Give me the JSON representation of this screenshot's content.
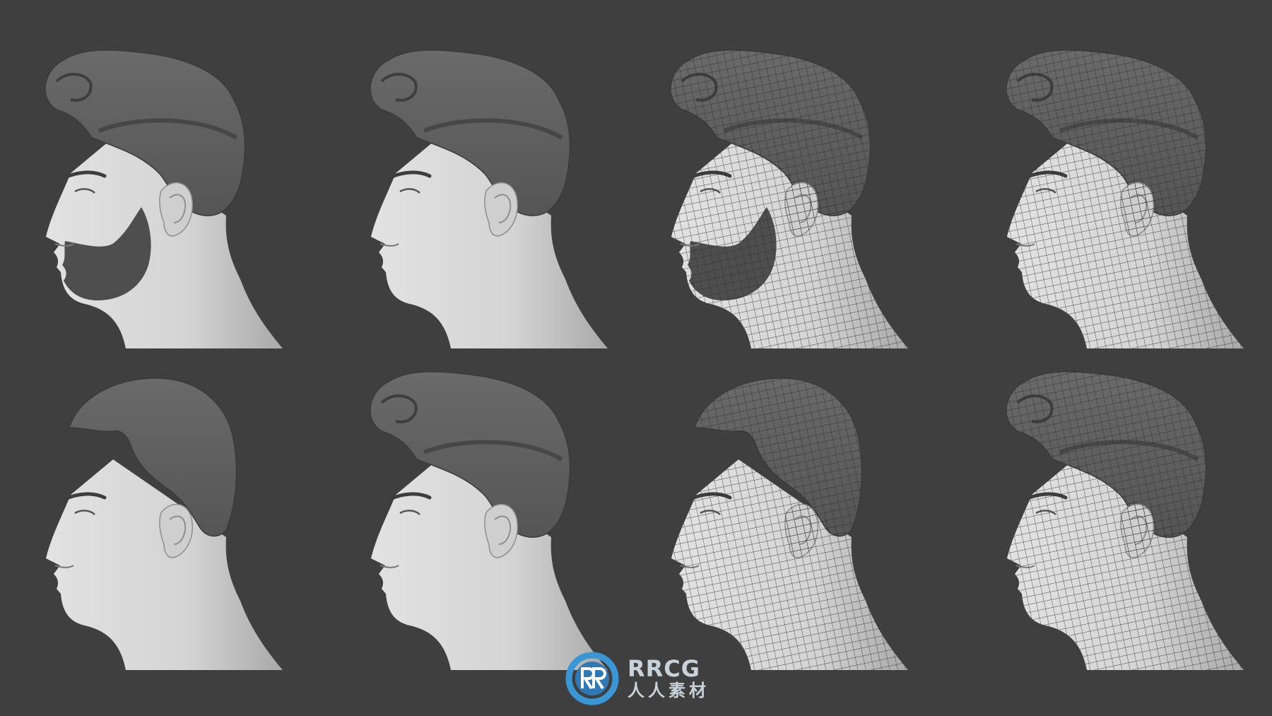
{
  "scene": {
    "background": "#3f3f3f",
    "skin_color": "#d4d4d4",
    "hair_color": "#555555",
    "wire_color": "#2a2a2a"
  },
  "busts": [
    {
      "name": "bearded-quiff",
      "hair": "quiff",
      "beard": true,
      "wireframe": false
    },
    {
      "name": "clean-quiff",
      "hair": "quiff",
      "beard": false,
      "wireframe": false
    },
    {
      "name": "bearded-quiff-wire",
      "hair": "quiff",
      "beard": true,
      "wireframe": true
    },
    {
      "name": "clean-quiff-wire",
      "hair": "quiff",
      "beard": false,
      "wireframe": true
    },
    {
      "name": "buzzcut",
      "hair": "buzz",
      "beard": false,
      "wireframe": false
    },
    {
      "name": "quiff-variant",
      "hair": "quiff",
      "beard": false,
      "wireframe": false
    },
    {
      "name": "buzzcut-wire",
      "hair": "buzz",
      "beard": false,
      "wireframe": true
    },
    {
      "name": "quiff-variant-wire",
      "hair": "quiff",
      "beard": false,
      "wireframe": true
    }
  ],
  "watermark": {
    "brand": "RRCG",
    "subtitle": "人人素材",
    "ring_color": "#3a97d6"
  }
}
